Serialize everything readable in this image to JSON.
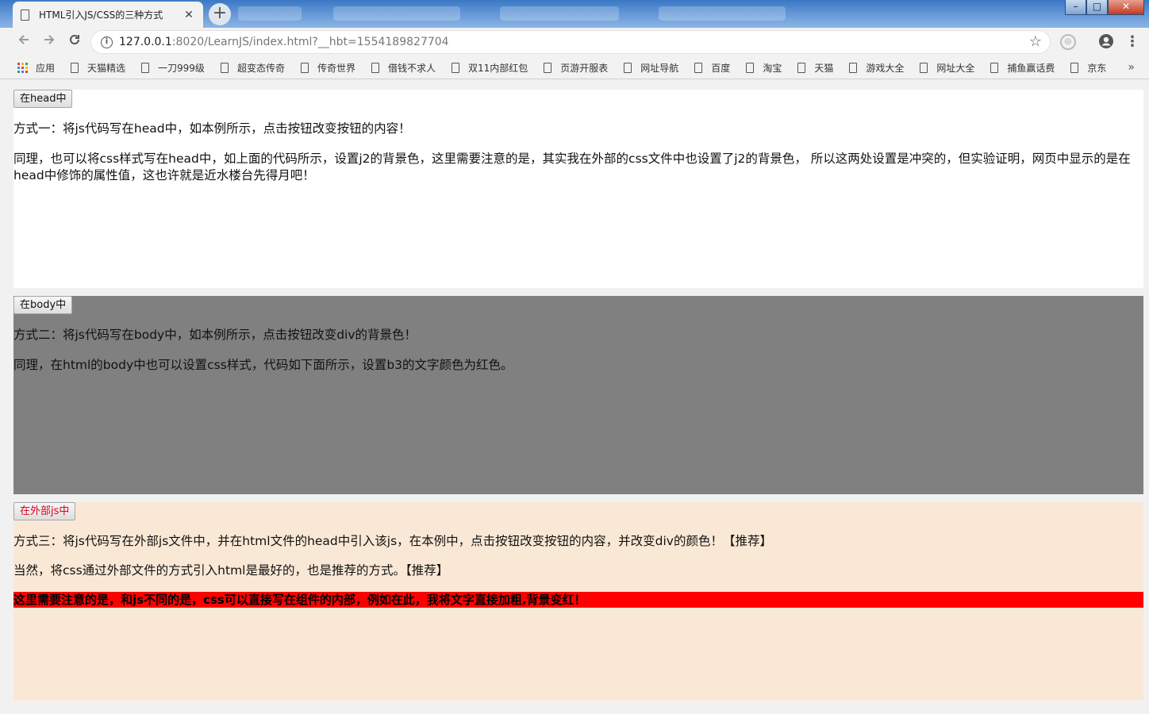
{
  "browser": {
    "tab": {
      "title": "HTML引入JS/CSS的三种方式",
      "close": "✕"
    },
    "new_tab": "+",
    "window": {
      "minimize": "–",
      "maximize": "□",
      "close": "✕"
    },
    "address": {
      "host": "127.0.0.1",
      "path": ":8020/LearnJS/index.html?__hbt=1554189827704"
    },
    "bookmarks": [
      "应用",
      "天猫精选",
      "一刀999级",
      "超变态传奇",
      "传奇世界",
      "借钱不求人",
      "双11内部红包",
      "页游开服表",
      "网址导航",
      "百度",
      "淘宝",
      "天猫",
      "游戏大全",
      "网址大全",
      "捕鱼赢话费",
      "京东"
    ],
    "bookmarks_more": "»"
  },
  "page": {
    "section1": {
      "button": "在head中",
      "p1": "方式一：将js代码写在head中，如本例所示，点击按钮改变按钮的内容！",
      "p2": "同理，也可以将css样式写在head中，如上面的代码所示，设置j2的背景色，这里需要注意的是，其实我在外部的css文件中也设置了j2的背景色， 所以这两处设置是冲突的，但实验证明，网页中显示的是在head中修饰的属性值，这也许就是近水楼台先得月吧！",
      "bg": "#ffffff"
    },
    "section2": {
      "button": "在body中",
      "p1": "方式二：将js代码写在body中，如本例所示，点击按钮改变div的背景色！",
      "p2": "同理，在html的body中也可以设置css样式，代码如下面所示，设置b3的文字颜色为红色。",
      "bg": "#808080"
    },
    "section3": {
      "button": "在外部js中",
      "p1": "方式三：将js代码写在外部js文件中，并在html文件的head中引入该js，在本例中，点击按钮改变按钮的内容，并改变div的颜色！【推荐】",
      "p2": "当然，将css通过外部文件的方式引入html是最好的，也是推荐的方式。【推荐】",
      "p3": "这里需要注意的是，和js不同的是，css可以直接写在组件的内部，例如在此，我将文字直接加粗,背景变红！",
      "bg": "#fae8d6",
      "highlight_bg": "#ff0000",
      "button_text_color": "#e4001a"
    }
  }
}
